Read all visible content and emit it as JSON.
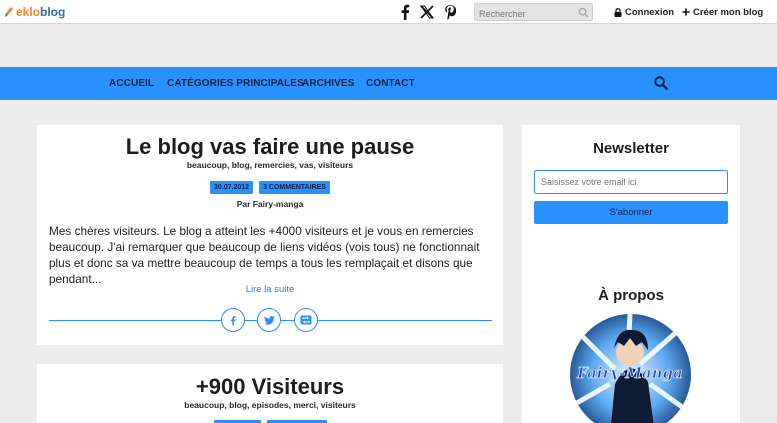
{
  "topbar": {
    "logo_part1": "eklo",
    "logo_part2": "blog",
    "search_placeholder": "Rechercher",
    "login_label": "Connexion",
    "create_label": "Créer mon blog"
  },
  "nav": {
    "items": [
      "ACCUEIL",
      "CATÉGORIES PRINCIPALES",
      "ARCHIVES",
      "CONTACT"
    ]
  },
  "posts": [
    {
      "title": "Le blog vas faire une pause",
      "tags": "beaucoup, blog, remercies, vas, visiteurs",
      "date": "30.07.2012",
      "comments": "3 COMMENTAIRES",
      "author": "Par Fairy-manga",
      "excerpt": "Mes chères visiteurs. Le blog a atteint les +4000 visiteurs et je vous en remercies beaucoup. J'ai remarquer que beaucoup de liens vidéos (vois tous) ne fonctionnait plus et donc sa va mettre beaucoup de temps a tous les remplaçait et disons que pendant...",
      "read_more": "Lire la suite"
    },
    {
      "title": "+900 Visiteurs",
      "tags": "beaucoup, blog, episodes, merci, visiteurs"
    }
  ],
  "sidebar": {
    "newsletter_title": "Newsletter",
    "email_placeholder": "Saisissez votre email ici",
    "subscribe_label": "S'abonner",
    "about_title": "À propos",
    "avatar_text": "Fairy-Manga"
  },
  "colors": {
    "accent": "#2990ff",
    "nav_text": "#0e2440",
    "background": "#ececec",
    "logo_orange": "#f28a1d",
    "logo_blue": "#2e6fb4"
  }
}
